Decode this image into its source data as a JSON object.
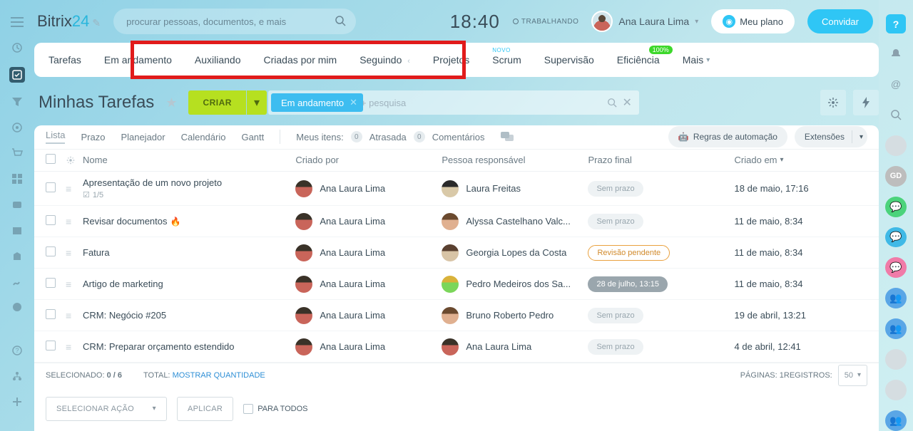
{
  "logo": {
    "part1": "Bitrix",
    "part2": "24"
  },
  "search": {
    "placeholder": "procurar pessoas, documentos, e mais"
  },
  "clock": "18:40",
  "work_status": "TRABALHANDO",
  "user_name": "Ana Laura Lima",
  "plan_button": "Meu plano",
  "invite_button": "Convidar",
  "tabs": {
    "tarefas": "Tarefas",
    "andamento": "Em andamento",
    "auxiliando": "Auxiliando",
    "criadas": "Criadas por mim",
    "seguindo": "Seguindo",
    "projetos": "Projetos",
    "scrum": "Scrum",
    "scrum_badge": "NOVO",
    "supervisao": "Supervisão",
    "eficiencia": "Eficiência",
    "eficiencia_badge": "100%",
    "mais": "Mais"
  },
  "page_title": "Minhas Tarefas",
  "create_button": "CRIAR",
  "filter_chip": "Em andamento",
  "filter_search_placeholder": "+ pesquisa",
  "subtabs": {
    "lista": "Lista",
    "prazo": "Prazo",
    "planejador": "Planejador",
    "calendario": "Calendário",
    "gantt": "Gantt",
    "meus": "Meus itens:",
    "atrasada": "Atrasada",
    "atrasada_cnt": "0",
    "coment": "Comentários",
    "coment_cnt": "0",
    "regras": "Regras de automação",
    "ext": "Extensões"
  },
  "columns": {
    "nome": "Nome",
    "criado_por": "Criado por",
    "responsavel": "Pessoa responsável",
    "prazo": "Prazo final",
    "criado_em": "Criado em"
  },
  "rows": [
    {
      "name": "Apresentação de um novo projeto",
      "sub": "1/5",
      "creator": "Ana Laura Lima",
      "resp": "Laura Freitas",
      "due": "Sem prazo",
      "due_type": "none",
      "created": "18 de maio, 17:16",
      "pa": "pa2"
    },
    {
      "name": "Revisar documentos",
      "flame": true,
      "creator": "Ana Laura Lima",
      "resp": "Alyssa Castelhano Valc...",
      "due": "Sem prazo",
      "due_type": "none",
      "created": "11 de maio, 8:34",
      "pa": "pa3"
    },
    {
      "name": "Fatura",
      "creator": "Ana Laura Lima",
      "resp": "Georgia Lopes da Costa",
      "due": "Revisão pendente",
      "due_type": "review",
      "created": "11 de maio, 8:34",
      "pa": "pa5"
    },
    {
      "name": "Artigo de marketing",
      "creator": "Ana Laura Lima",
      "resp": "Pedro Medeiros dos Sa...",
      "due": "28 de julho, 13:15",
      "due_type": "date",
      "created": "11 de maio, 8:34",
      "pa": "pa4"
    },
    {
      "name": "CRM: Negócio #205",
      "creator": "Ana Laura Lima",
      "resp": "Bruno Roberto Pedro",
      "due": "Sem prazo",
      "due_type": "none",
      "created": "19 de abril, 13:21",
      "pa": "pa3"
    },
    {
      "name": "CRM: Preparar orçamento estendido",
      "creator": "Ana Laura Lima",
      "resp": "Ana Laura Lima",
      "due": "Sem prazo",
      "due_type": "none",
      "created": "4 de abril, 12:41",
      "pa": "pa1"
    }
  ],
  "footer": {
    "selecionado": "SELECIONADO:",
    "sel_val": "0 / 6",
    "total": "TOTAL:",
    "total_link": "MOSTRAR QUANTIDADE",
    "paginas": "PÁGINAS:",
    "pag_val": "1",
    "registros": "REGISTROS:",
    "reg_val": "50"
  },
  "actions": {
    "select": "SELECIONAR AÇÃO",
    "aplicar": "APLICAR",
    "todos": "PARA TODOS"
  }
}
